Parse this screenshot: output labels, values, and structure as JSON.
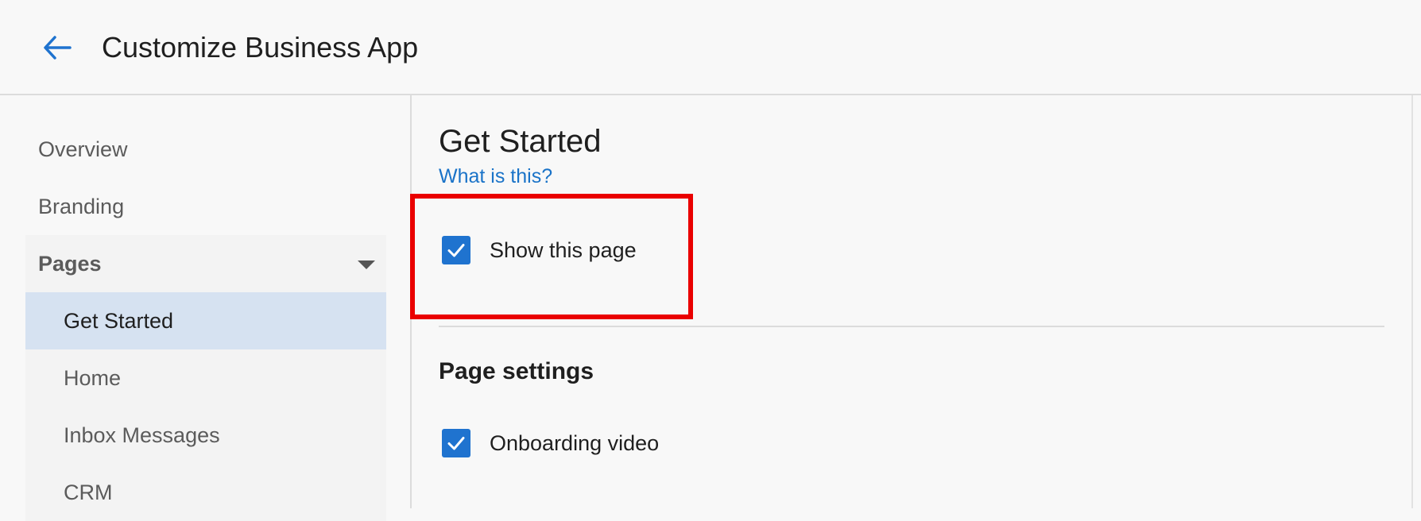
{
  "header": {
    "back_icon": "arrow-left-icon",
    "title": "Customize Business App"
  },
  "sidebar": {
    "items": [
      {
        "label": "Overview"
      },
      {
        "label": "Branding"
      }
    ],
    "pages_group": {
      "label": "Pages",
      "expanded": true,
      "items": [
        {
          "label": "Get Started",
          "active": true
        },
        {
          "label": "Home",
          "active": false
        },
        {
          "label": "Inbox Messages",
          "active": false
        },
        {
          "label": "CRM",
          "active": false
        }
      ]
    }
  },
  "main": {
    "title": "Get Started",
    "help_link": "What is this?",
    "show_page": {
      "label": "Show this page",
      "checked": true
    },
    "page_settings": {
      "title": "Page settings",
      "options": [
        {
          "label": "Onboarding video",
          "checked": true
        }
      ]
    }
  },
  "colors": {
    "accent": "#1f73cf",
    "link": "#1a73c8",
    "active_nav_bg": "#d6e2f1",
    "highlight_border": "#ea0000",
    "background": "#f8f8f8"
  }
}
